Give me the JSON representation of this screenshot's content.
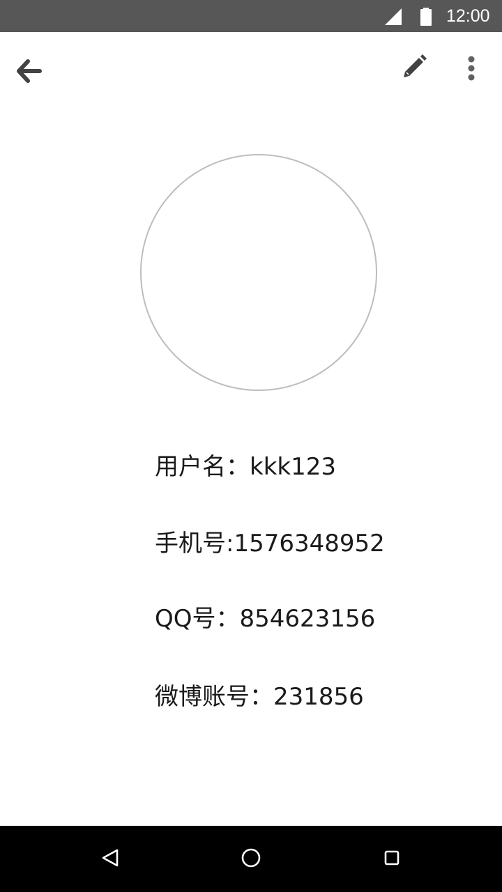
{
  "status_bar": {
    "time": "12:00",
    "icons": [
      "signal-icon",
      "battery-icon"
    ]
  },
  "toolbar": {
    "icons": [
      "back-arrow-icon",
      "edit-pencil-icon",
      "more-vert-icon"
    ]
  },
  "profile": {
    "username": "用户名：kkk123",
    "phone": "手机号:1576348952",
    "qq": "QQ号：854623156",
    "weibo": "微博账号：231856"
  },
  "nav_bar": {
    "icons": [
      "nav-back-icon",
      "nav-home-icon",
      "nav-recent-icon"
    ]
  },
  "colors": {
    "status_bar_bg": "#575757",
    "toolbar_icon": "#424242",
    "avatar_border": "#bdbdbd",
    "nav_bar_bg": "#000000"
  }
}
